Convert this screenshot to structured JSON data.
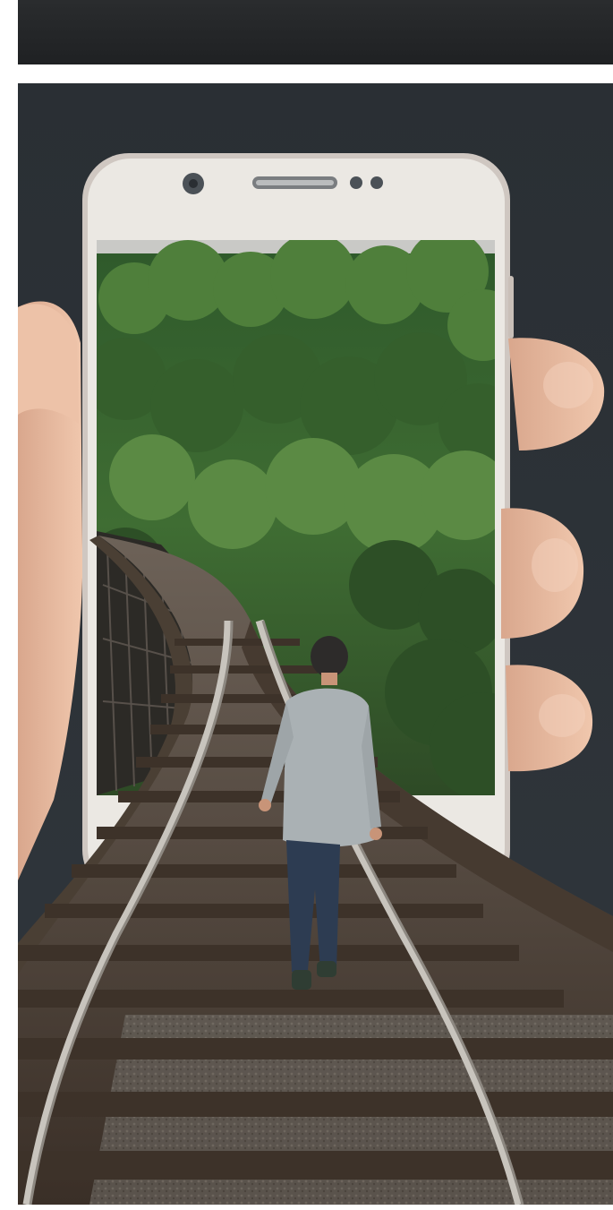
{
  "header": {
    "background_color": "#24272a"
  },
  "photo": {
    "subject": "hand-holding-smartphone-railway-trestle",
    "palette": {
      "backdrop": "#2b3035",
      "phone_body": "#e9e6e0",
      "phone_frame": "#cfc7c1",
      "foliage": "#3e6b33",
      "track_wood": "#5b4a3b",
      "rail": "#b8b5ae",
      "skin": "#e3b49a",
      "shirt": "#aeb4b7",
      "jeans": "#2c3b50"
    }
  }
}
